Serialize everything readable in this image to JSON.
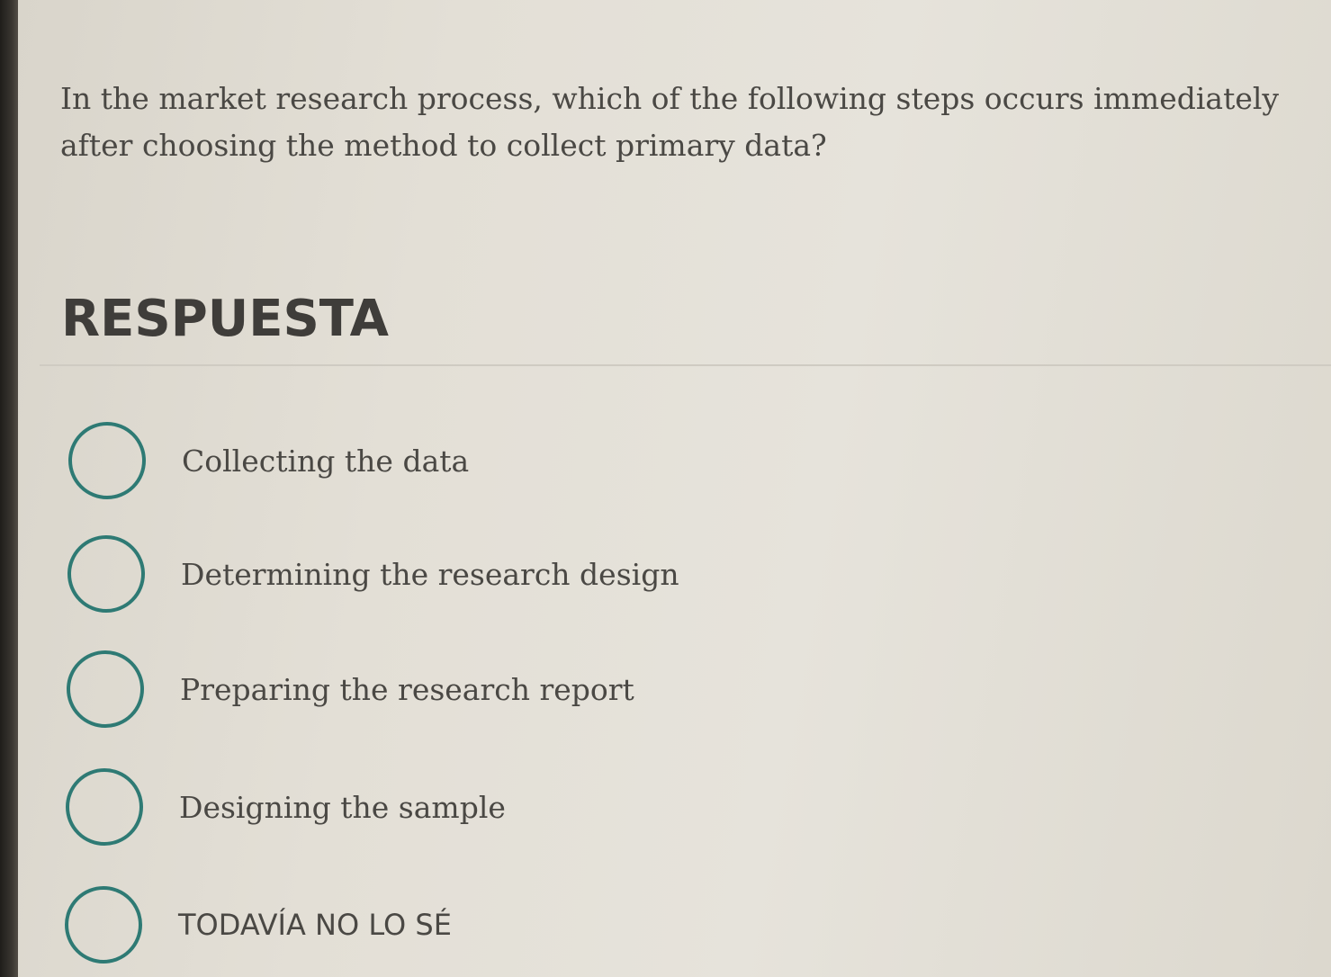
{
  "question": {
    "text": "In the market research process, which of the following steps occurs immediately after choosing the method to collect primary data?"
  },
  "answer_section": {
    "heading": "RESPUESTA"
  },
  "options": [
    {
      "label": "Collecting the data",
      "selected": false
    },
    {
      "label": "Determining the research design",
      "selected": false
    },
    {
      "label": "Preparing the research report",
      "selected": false
    },
    {
      "label": "Designing the sample",
      "selected": false
    },
    {
      "label": "TODAVÍA NO LO SÉ",
      "selected": false
    }
  ],
  "colors": {
    "radio_border": "#2e7a74",
    "text": "#4a4844",
    "background": "#e3dfd6"
  }
}
